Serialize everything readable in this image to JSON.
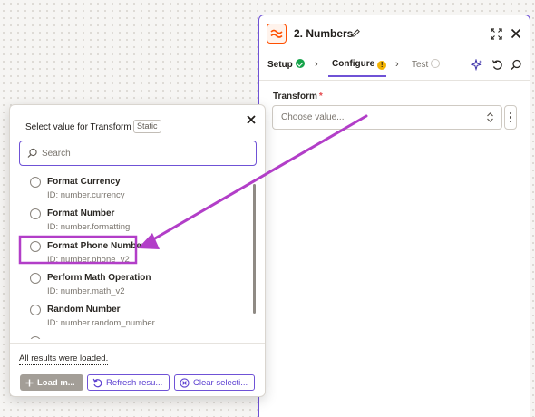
{
  "panel": {
    "step_title": "2. Numbers",
    "tabs": [
      {
        "label": "Setup",
        "status": "complete"
      },
      {
        "label": "Configure",
        "status": "warning",
        "status_symbol": "!"
      },
      {
        "label": "Test",
        "status": "pending"
      }
    ],
    "active_tab": "Configure",
    "field": {
      "label": "Transform",
      "required_marker": "*",
      "placeholder": "Choose value..."
    },
    "icons": [
      "numbers-app-icon",
      "pencil-icon",
      "expand-icon",
      "close-icon",
      "sparkle-icon",
      "undo-icon",
      "search-icon",
      "kebab-menu-icon"
    ]
  },
  "popup": {
    "title": "Select value for Transform",
    "badge": "Static",
    "search_placeholder": "Search",
    "results": [
      {
        "name": "Format Currency",
        "id": "ID: number.currency"
      },
      {
        "name": "Format Number",
        "id": "ID: number.formatting"
      },
      {
        "name": "Format Phone Number",
        "id": "ID: number.phone_v2"
      },
      {
        "name": "Perform Math Operation",
        "id": "ID: number.math_v2"
      },
      {
        "name": "Random Number",
        "id": "ID: number.random_number"
      }
    ],
    "highlighted_result": "Format Phone Number",
    "status_text": "All results were loaded.",
    "buttons": {
      "load_more": "Load m...",
      "refresh": "Refresh resu...",
      "clear": "Clear selecti..."
    }
  },
  "colors": {
    "accent": "#6f52d6",
    "annotation": "#b23ec8",
    "brand_orange": "#ff4f00",
    "success": "#16a34a",
    "warning": "#f3b300"
  }
}
